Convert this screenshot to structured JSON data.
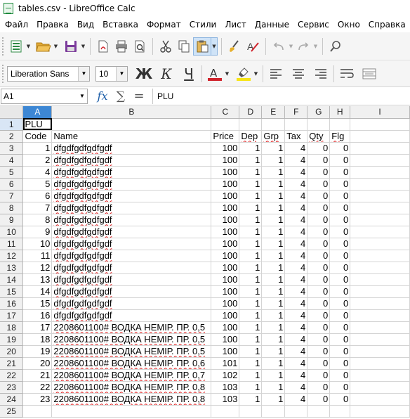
{
  "window": {
    "title": "tables.csv - LibreOffice Calc"
  },
  "menu": [
    "Файл",
    "Правка",
    "Вид",
    "Вставка",
    "Формат",
    "Стили",
    "Лист",
    "Данные",
    "Сервис",
    "Окно",
    "Справка"
  ],
  "toolbar": {
    "font_name": "Liberation Sans",
    "font_size": "10",
    "bold_label": "Ж",
    "italic_label": "К",
    "underline_label": "Ч",
    "font_color": "#d0222a",
    "highlight_color": "#f7e414"
  },
  "formula_bar": {
    "cell_ref": "A1",
    "fx_label": "fx",
    "sum_label": "∑",
    "equals_label": "=",
    "content": "PLU"
  },
  "columns": [
    "A",
    "B",
    "C",
    "D",
    "E",
    "F",
    "G",
    "H",
    "I"
  ],
  "rows": [
    [
      "PLU",
      "",
      "",
      "",
      "",
      "",
      "",
      "",
      ""
    ],
    [
      "Code",
      "Name",
      "Price",
      "Dep",
      "Grp",
      "Tax",
      "Qty",
      "Flg",
      ""
    ],
    [
      "1",
      "dfgdfgdfgdfgdf",
      "100",
      "1",
      "1",
      "4",
      "0",
      "0",
      ""
    ],
    [
      "2",
      "dfgdfgdfgdfgdf",
      "100",
      "1",
      "1",
      "4",
      "0",
      "0",
      ""
    ],
    [
      "4",
      "dfgdfgdfgdfgdf",
      "100",
      "1",
      "1",
      "4",
      "0",
      "0",
      ""
    ],
    [
      "5",
      "dfgdfgdfgdfgdf",
      "100",
      "1",
      "1",
      "4",
      "0",
      "0",
      ""
    ],
    [
      "6",
      "dfgdfgdfgdfgdf",
      "100",
      "1",
      "1",
      "4",
      "0",
      "0",
      ""
    ],
    [
      "7",
      "dfgdfgdfgdfgdf",
      "100",
      "1",
      "1",
      "4",
      "0",
      "0",
      ""
    ],
    [
      "8",
      "dfgdfgdfgdfgdf",
      "100",
      "1",
      "1",
      "4",
      "0",
      "0",
      ""
    ],
    [
      "9",
      "dfgdfgdfgdfgdf",
      "100",
      "1",
      "1",
      "4",
      "0",
      "0",
      ""
    ],
    [
      "10",
      "dfgdfgdfgdfgdf",
      "100",
      "1",
      "1",
      "4",
      "0",
      "0",
      ""
    ],
    [
      "11",
      "dfgdfgdfgdfgdf",
      "100",
      "1",
      "1",
      "4",
      "0",
      "0",
      ""
    ],
    [
      "12",
      "dfgdfgdfgdfgdf",
      "100",
      "1",
      "1",
      "4",
      "0",
      "0",
      ""
    ],
    [
      "13",
      "dfgdfgdfgdfgdf",
      "100",
      "1",
      "1",
      "4",
      "0",
      "0",
      ""
    ],
    [
      "14",
      "dfgdfgdfgdfgdf",
      "100",
      "1",
      "1",
      "4",
      "0",
      "0",
      ""
    ],
    [
      "15",
      "dfgdfgdfgdfgdf",
      "100",
      "1",
      "1",
      "4",
      "0",
      "0",
      ""
    ],
    [
      "16",
      "dfgdfgdfgdfgdf",
      "100",
      "1",
      "1",
      "4",
      "0",
      "0",
      ""
    ],
    [
      "17",
      "2208601100# ВОДКА НЕМІР. ПР. 0,5",
      "100",
      "1",
      "1",
      "4",
      "0",
      "0",
      ""
    ],
    [
      "18",
      "2208601100# ВОДКА НЕМІР. ПР. 0,5",
      "100",
      "1",
      "1",
      "4",
      "0",
      "0",
      ""
    ],
    [
      "19",
      "2208601100# ВОДКА НЕМІР. ПР. 0,5",
      "100",
      "1",
      "1",
      "4",
      "0",
      "0",
      ""
    ],
    [
      "20",
      "2208601100# ВОДКА НЕМІР. ПР. 0,6",
      "101",
      "1",
      "1",
      "4",
      "0",
      "0",
      ""
    ],
    [
      "21",
      "2208601100# ВОДКА НЕМІР. ПР. 0,7",
      "102",
      "1",
      "1",
      "4",
      "0",
      "0",
      ""
    ],
    [
      "22",
      "2208601100# ВОДКА НЕМІР. ПР. 0,8",
      "103",
      "1",
      "1",
      "4",
      "0",
      "0",
      ""
    ],
    [
      "23",
      "2208601100# ВОДКА НЕМІР. ПР. 0,8",
      "103",
      "1",
      "1",
      "4",
      "0",
      "0",
      ""
    ],
    [
      "",
      "",
      "",
      "",
      "",
      "",
      "",
      "",
      ""
    ]
  ]
}
